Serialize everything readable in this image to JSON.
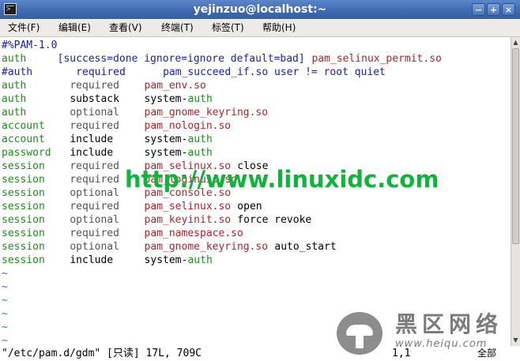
{
  "window": {
    "title": "yejinzuo@localhost:~",
    "buttons": {
      "minimize": "−",
      "maximize": "+",
      "close": "×"
    }
  },
  "menubar": [
    "文件(F)",
    "编辑(E)",
    "查看(V)",
    "终端(T)",
    "标签(T)",
    "帮助(H)"
  ],
  "lines": [
    {
      "tokens": [
        {
          "text": "#%PAM-1.0",
          "cls": "c-blue",
          "col": 0
        }
      ]
    },
    {
      "tokens": [
        {
          "text": "auth",
          "cls": "c-green",
          "col": 0
        },
        {
          "text": "[success=done ignore=ignore default=bad]",
          "cls": "c-blue",
          "col": 9
        },
        {
          "text": "pam_selinux_permit.so",
          "cls": "c-red",
          "col": 50
        }
      ]
    },
    {
      "tokens": [
        {
          "text": "#auth",
          "cls": "c-blue",
          "col": 0
        },
        {
          "text": "required",
          "cls": "c-blue",
          "col": 12
        },
        {
          "text": "pam_succeed_if.so user != root quiet",
          "cls": "c-blue",
          "col": 26
        }
      ]
    },
    {
      "tokens": [
        {
          "text": "auth",
          "cls": "c-green",
          "col": 0
        },
        {
          "text": "required",
          "cls": "c-gray",
          "col": 11
        },
        {
          "text": "pam_env.so",
          "cls": "c-red",
          "col": 23
        }
      ]
    },
    {
      "tokens": [
        {
          "text": "auth",
          "cls": "c-green",
          "col": 0
        },
        {
          "text": "substack",
          "cls": "",
          "col": 11
        },
        {
          "text": "system-",
          "cls": "",
          "col": 23
        },
        {
          "text": "auth",
          "cls": "c-green",
          "col": 30
        }
      ]
    },
    {
      "tokens": [
        {
          "text": "auth",
          "cls": "c-green",
          "col": 0
        },
        {
          "text": "optional",
          "cls": "c-gray",
          "col": 11
        },
        {
          "text": "pam_gnome_keyring.so",
          "cls": "c-red",
          "col": 23
        }
      ]
    },
    {
      "tokens": [
        {
          "text": "account",
          "cls": "c-green",
          "col": 0
        },
        {
          "text": "required",
          "cls": "c-gray",
          "col": 11
        },
        {
          "text": "pam_nologin.so",
          "cls": "c-red",
          "col": 23
        }
      ]
    },
    {
      "tokens": [
        {
          "text": "account",
          "cls": "c-green",
          "col": 0
        },
        {
          "text": "include",
          "cls": "",
          "col": 11
        },
        {
          "text": "system-",
          "cls": "",
          "col": 23
        },
        {
          "text": "auth",
          "cls": "c-green",
          "col": 30
        }
      ]
    },
    {
      "tokens": [
        {
          "text": "password",
          "cls": "c-green",
          "col": 0
        },
        {
          "text": "include",
          "cls": "",
          "col": 11
        },
        {
          "text": "system-",
          "cls": "",
          "col": 23
        },
        {
          "text": "auth",
          "cls": "c-green",
          "col": 30
        }
      ]
    },
    {
      "tokens": [
        {
          "text": "session",
          "cls": "c-green",
          "col": 0
        },
        {
          "text": "required",
          "cls": "c-gray",
          "col": 11
        },
        {
          "text": "pam_selinux.so",
          "cls": "c-red",
          "col": 23
        },
        {
          "text": "close",
          "cls": "",
          "col": 38
        }
      ]
    },
    {
      "tokens": [
        {
          "text": "session",
          "cls": "c-green",
          "col": 0
        },
        {
          "text": "required",
          "cls": "c-gray",
          "col": 11
        },
        {
          "text": "pam_loginuid.so",
          "cls": "c-red",
          "col": 23
        }
      ]
    },
    {
      "tokens": [
        {
          "text": "session",
          "cls": "c-green",
          "col": 0
        },
        {
          "text": "optional",
          "cls": "c-gray",
          "col": 11
        },
        {
          "text": "pam_console.so",
          "cls": "c-red",
          "col": 23
        }
      ]
    },
    {
      "tokens": [
        {
          "text": "session",
          "cls": "c-green",
          "col": 0
        },
        {
          "text": "required",
          "cls": "c-gray",
          "col": 11
        },
        {
          "text": "pam_selinux.so",
          "cls": "c-red",
          "col": 23
        },
        {
          "text": "open",
          "cls": "",
          "col": 38
        }
      ]
    },
    {
      "tokens": [
        {
          "text": "session",
          "cls": "c-green",
          "col": 0
        },
        {
          "text": "optional",
          "cls": "c-gray",
          "col": 11
        },
        {
          "text": "pam_keyinit.so",
          "cls": "c-red",
          "col": 23
        },
        {
          "text": "force revoke",
          "cls": "",
          "col": 38
        }
      ]
    },
    {
      "tokens": [
        {
          "text": "session",
          "cls": "c-green",
          "col": 0
        },
        {
          "text": "required",
          "cls": "c-gray",
          "col": 11
        },
        {
          "text": "pam_namespace.so",
          "cls": "c-red",
          "col": 23
        }
      ]
    },
    {
      "tokens": [
        {
          "text": "session",
          "cls": "c-green",
          "col": 0
        },
        {
          "text": "optional",
          "cls": "c-gray",
          "col": 11
        },
        {
          "text": "pam_gnome_keyring.so",
          "cls": "c-red",
          "col": 23
        },
        {
          "text": "auto_start",
          "cls": "",
          "col": 44
        }
      ]
    },
    {
      "tokens": [
        {
          "text": "session",
          "cls": "c-green",
          "col": 0
        },
        {
          "text": "include",
          "cls": "",
          "col": 11
        },
        {
          "text": "system-",
          "cls": "",
          "col": 23
        },
        {
          "text": "auth",
          "cls": "c-green",
          "col": 30
        }
      ]
    },
    {
      "tokens": [
        {
          "text": "~",
          "cls": "c-tilde",
          "col": 0
        }
      ]
    },
    {
      "tokens": [
        {
          "text": "~",
          "cls": "c-tilde",
          "col": 0
        }
      ]
    },
    {
      "tokens": [
        {
          "text": "~",
          "cls": "c-tilde",
          "col": 0
        }
      ]
    },
    {
      "tokens": [
        {
          "text": "~",
          "cls": "c-tilde",
          "col": 0
        }
      ]
    },
    {
      "tokens": [
        {
          "text": "~",
          "cls": "c-tilde",
          "col": 0
        }
      ]
    },
    {
      "tokens": [
        {
          "text": "~",
          "cls": "c-tilde",
          "col": 0
        }
      ]
    }
  ],
  "status": {
    "file": "\"/etc/pam.d/gdm\" [只读] 17L, 709C",
    "position": "1,1",
    "scroll": "全部"
  },
  "watermark": "http://www.linuxidc.com",
  "logo": {
    "title": "黑区网络",
    "url": "www.heiqu.com"
  },
  "colors": {
    "titlebar": "#3f6bb3",
    "keyword_green": "#1b8f1b",
    "module_red": "#b8202a",
    "comment_blue": "#1c1cb5",
    "watermark_green": "#0fb43a"
  }
}
